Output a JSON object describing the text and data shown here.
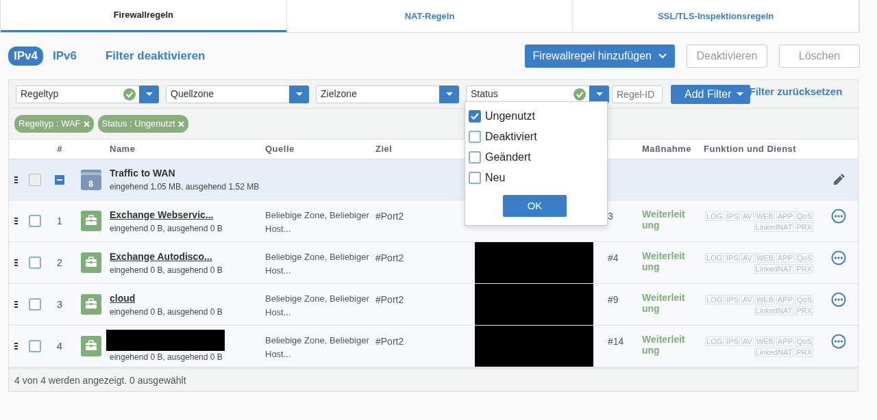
{
  "tabs": [
    {
      "label": "Firewallregeln",
      "selected": true
    },
    {
      "label": "NAT-Regeln",
      "selected": false
    },
    {
      "label": "SSL/TLS-Inspektionsregeln",
      "selected": false
    }
  ],
  "ip_versions": [
    {
      "label": "IPv4",
      "selected": true
    },
    {
      "label": "IPv6",
      "selected": false
    }
  ],
  "filter_toggle": "Filter deaktivieren",
  "actions": [
    {
      "label": "Firewallregel hinzufügen",
      "kind": "primary"
    },
    {
      "label": "Deaktivieren",
      "kind": "plain",
      "disabled": true
    },
    {
      "label": "Löschen",
      "kind": "plain",
      "disabled": true
    }
  ],
  "filters": [
    {
      "label": "Regeltyp",
      "active": true
    },
    {
      "label": "Quellzone",
      "active": false
    },
    {
      "label": "Zielzone",
      "active": false
    },
    {
      "label": "Status",
      "active": true
    }
  ],
  "rule_id": {
    "placeholder": "Regel-ID"
  },
  "add_filter": "Add Filter",
  "reset_filters": "Filter zurücksetzen",
  "chips": [
    "Regeltyp : WAF",
    "Status : Ungenutzt"
  ],
  "columns": [
    "#",
    "Name",
    "Quelle",
    "Ziel",
    "Maßnahme",
    "Funktion und Dienst"
  ],
  "group": {
    "name": "Traffic to WAN",
    "stats": "eingehend 1.05 MB, ausgehend 1.52 MB",
    "count": "8",
    "checked": false,
    "expanded": true
  },
  "rules": [
    {
      "number": "1",
      "name": "Exchange Webservic...",
      "name_redacted": false,
      "stats": "eingehend 0 B, ausgehend 0 B",
      "source": "Beliebige Zone, Beliebiger Host...",
      "destination": "#Port2",
      "destination_redacted": false,
      "service": "3",
      "action": "Weiterleitung",
      "tags": [
        "LOG",
        "IPS",
        "AV",
        "WEB",
        "APP",
        "QoS",
        "LinkedNAT",
        "PRX"
      ],
      "checked": false
    },
    {
      "number": "2",
      "name": "Exchange Autodisco...",
      "name_redacted": false,
      "stats": "eingehend 0 B, ausgehend 0 B",
      "source": "Beliebige Zone, Beliebiger Host...",
      "destination": "#Port2",
      "destination_redacted": true,
      "service": "#4",
      "action": "Weiterleitung",
      "tags": [
        "LOG",
        "IPS",
        "AV",
        "WEB",
        "APP",
        "QoS",
        "LinkedNAT",
        "PRX"
      ],
      "checked": false
    },
    {
      "number": "3",
      "name": "cloud",
      "name_redacted": false,
      "stats": "eingehend 0 B, ausgehend 0 B",
      "source": "Beliebige Zone, Beliebiger Host...",
      "destination": "#Port2",
      "destination_redacted": true,
      "service": "#9",
      "action": "Weiterleitung",
      "tags": [
        "LOG",
        "IPS",
        "AV",
        "WEB",
        "APP",
        "QoS",
        "LinkedNAT",
        "PRX"
      ],
      "checked": false
    },
    {
      "number": "4",
      "name_redacted": true,
      "stats": "eingehend 0 B, ausgehend 0 B",
      "source": "Beliebige Zone, Beliebiger Host...",
      "destination": "#Port2",
      "destination_redacted": true,
      "service": "#14",
      "action": "Weiterleitung",
      "tags": [
        "LOG",
        "IPS",
        "AV",
        "WEB",
        "APP",
        "QoS",
        "LinkedNAT",
        "PRX"
      ],
      "checked": false
    }
  ],
  "status_menu": {
    "options": [
      {
        "label": "Ungenutzt",
        "checked": true
      },
      {
        "label": "Deaktiviert",
        "checked": false
      },
      {
        "label": "Geändert",
        "checked": false
      },
      {
        "label": "Neu",
        "checked": false
      }
    ],
    "ok": "OK"
  },
  "footer": "4 von 4 werden angezeigt. 0 ausgewählt"
}
